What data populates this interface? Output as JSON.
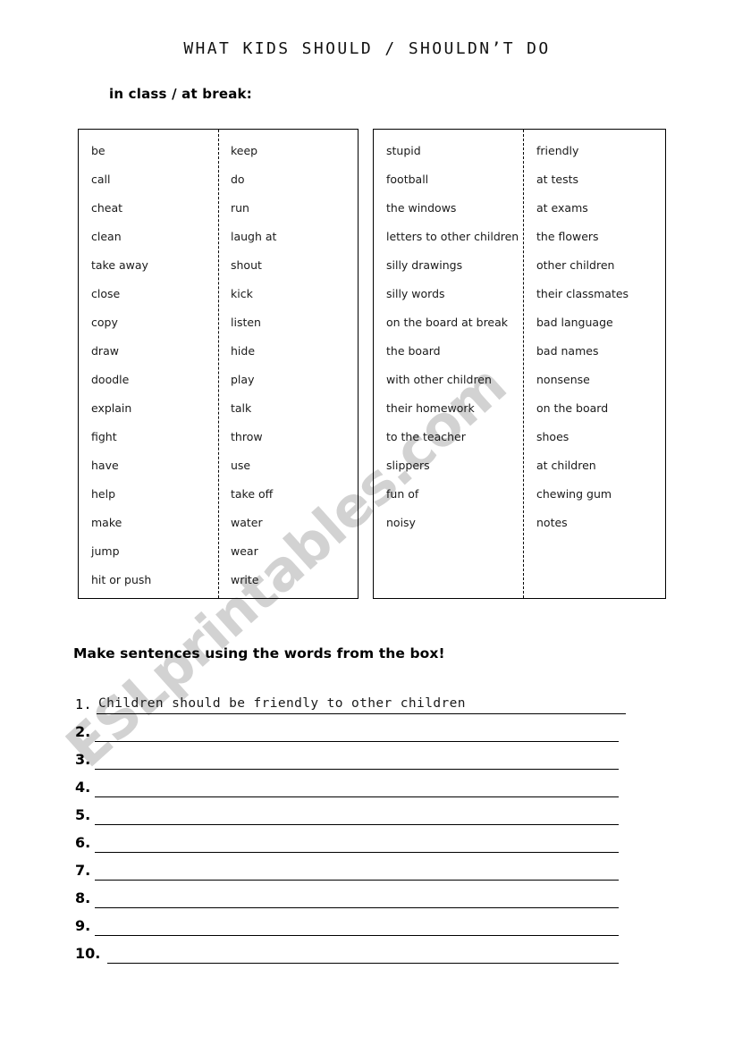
{
  "worksheet": {
    "title": "WHAT KIDS SHOULD / SHOULDN’T DO",
    "subtitle": "in class / at break:",
    "instruction": "Make sentences using the words from the box!",
    "watermark": "ESLprintables.com"
  },
  "word_box_1": {
    "left_column": [
      "be",
      "call",
      "cheat",
      "clean",
      "take away",
      "close",
      "copy",
      "draw",
      "doodle",
      "explain",
      "fight",
      "have",
      "help",
      "make",
      "jump",
      "hit or push"
    ],
    "right_column": [
      "keep",
      "do",
      "run",
      "laugh at",
      "shout",
      "kick",
      "listen",
      "hide",
      "play",
      "talk",
      "throw",
      "use",
      "take off",
      "water",
      "wear",
      "write"
    ]
  },
  "word_box_2": {
    "left_column": [
      "stupid",
      "football",
      "the windows",
      "letters to other children",
      "silly drawings",
      "silly words",
      "on the board at break",
      "the board",
      "with other children",
      "their homework",
      "to the teacher",
      "slippers",
      "fun of",
      "noisy"
    ],
    "right_column": [
      "friendly",
      "at tests",
      "at exams",
      "the flowers",
      "other children",
      "their classmates",
      "bad language",
      "bad names",
      "nonsense",
      "on the board",
      "shoes",
      "at children",
      "chewing gum",
      "notes"
    ]
  },
  "answers": [
    {
      "number": "1.",
      "text": "Children should be friendly to other children"
    },
    {
      "number": "2.",
      "text": ""
    },
    {
      "number": "3.",
      "text": ""
    },
    {
      "number": "4.",
      "text": ""
    },
    {
      "number": "5.",
      "text": ""
    },
    {
      "number": "6.",
      "text": ""
    },
    {
      "number": "7.",
      "text": ""
    },
    {
      "number": "8.",
      "text": ""
    },
    {
      "number": "9.",
      "text": ""
    },
    {
      "number": "10.",
      "text": ""
    }
  ]
}
